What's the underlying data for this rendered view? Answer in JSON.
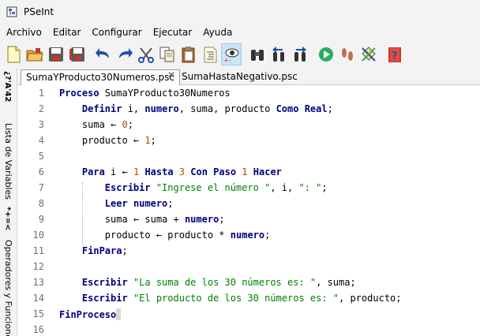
{
  "window": {
    "title": "PSeInt"
  },
  "menu": [
    "Archivo",
    "Editar",
    "Configurar",
    "Ejecutar",
    "Ayuda"
  ],
  "toolbar": [
    {
      "name": "new-file",
      "icon": "new-file-icon"
    },
    {
      "name": "open-file",
      "icon": "open-folder-icon"
    },
    {
      "name": "save",
      "icon": "save-icon"
    },
    {
      "name": "save-as",
      "icon": "save-as-icon"
    },
    {
      "name": "undo",
      "icon": "undo-icon"
    },
    {
      "name": "redo",
      "icon": "redo-icon"
    },
    {
      "name": "cut",
      "icon": "scissors-icon"
    },
    {
      "name": "copy",
      "icon": "copy-icon"
    },
    {
      "name": "paste",
      "icon": "paste-icon"
    },
    {
      "name": "indent",
      "icon": "indent-icon"
    },
    {
      "name": "watch-vars",
      "icon": "eye-icon"
    },
    {
      "name": "find",
      "icon": "binoculars-icon"
    },
    {
      "name": "find-prev",
      "icon": "find-prev-icon"
    },
    {
      "name": "find-next",
      "icon": "find-next-icon"
    },
    {
      "name": "run",
      "icon": "play-icon"
    },
    {
      "name": "step-by-step",
      "icon": "footsteps-icon"
    },
    {
      "name": "flowchart",
      "icon": "flowchart-icon"
    },
    {
      "name": "help",
      "icon": "help-icon"
    }
  ],
  "side_panels": {
    "variables": "Lista de Variables",
    "operators": "Operadores y Funciones",
    "variables_symbol": "*+=<",
    "top_symbol": "¿?'A'42"
  },
  "tabs": [
    {
      "label": "SumaYProducto30Numeros.psc",
      "active": true,
      "close": "✕"
    },
    {
      "label": "SumaHastaNegativo.psc",
      "active": false
    }
  ],
  "code": {
    "line_numbers": [
      "1",
      "2",
      "3",
      "4",
      "5",
      "6",
      "7",
      "8",
      "9",
      "10",
      "11",
      "12",
      "13",
      "14",
      "15",
      "16"
    ],
    "lines": [
      [
        [
          "kw",
          "Proceso"
        ],
        [
          "t",
          " SumaYProducto30Numeros"
        ]
      ],
      [
        [
          "t",
          "    "
        ],
        [
          "kw",
          "Definir"
        ],
        [
          "t",
          " i, "
        ],
        [
          "kw",
          "numero"
        ],
        [
          "t",
          ", suma, producto "
        ],
        [
          "kw",
          "Como Real"
        ],
        [
          "t",
          ";"
        ]
      ],
      [
        [
          "t",
          "    suma "
        ],
        [
          "op",
          "←"
        ],
        [
          "t",
          " "
        ],
        [
          "num",
          "0"
        ],
        [
          "t",
          ";"
        ]
      ],
      [
        [
          "t",
          "    producto "
        ],
        [
          "op",
          "←"
        ],
        [
          "t",
          " "
        ],
        [
          "num",
          "1"
        ],
        [
          "t",
          ";"
        ]
      ],
      [
        [
          "t",
          ""
        ]
      ],
      [
        [
          "t",
          "    "
        ],
        [
          "kw",
          "Para"
        ],
        [
          "t",
          " i "
        ],
        [
          "op",
          "←"
        ],
        [
          "t",
          " "
        ],
        [
          "num",
          "1"
        ],
        [
          "t",
          " "
        ],
        [
          "kw",
          "Hasta"
        ],
        [
          "t",
          " "
        ],
        [
          "num",
          "3"
        ],
        [
          "t",
          " "
        ],
        [
          "kw",
          "Con Paso"
        ],
        [
          "t",
          " "
        ],
        [
          "num",
          "1"
        ],
        [
          "t",
          " "
        ],
        [
          "kw",
          "Hacer"
        ]
      ],
      [
        [
          "t",
          "        "
        ],
        [
          "kw",
          "Escribir"
        ],
        [
          "t",
          " "
        ],
        [
          "str",
          "\"Ingrese el número \""
        ],
        [
          "t",
          ", i, "
        ],
        [
          "str",
          "\": \""
        ],
        [
          "t",
          ";"
        ]
      ],
      [
        [
          "t",
          "        "
        ],
        [
          "kw",
          "Leer"
        ],
        [
          "t",
          " "
        ],
        [
          "kw",
          "numero"
        ],
        [
          "t",
          ";"
        ]
      ],
      [
        [
          "t",
          "        suma "
        ],
        [
          "op",
          "←"
        ],
        [
          "t",
          " suma + "
        ],
        [
          "kw",
          "numero"
        ],
        [
          "t",
          ";"
        ]
      ],
      [
        [
          "t",
          "        producto "
        ],
        [
          "op",
          "←"
        ],
        [
          "t",
          " producto * "
        ],
        [
          "kw",
          "numero"
        ],
        [
          "t",
          ";"
        ]
      ],
      [
        [
          "t",
          "    "
        ],
        [
          "kw",
          "FinPara"
        ],
        [
          "t",
          ";"
        ]
      ],
      [
        [
          "t",
          ""
        ]
      ],
      [
        [
          "t",
          "    "
        ],
        [
          "kw",
          "Escribir"
        ],
        [
          "t",
          " "
        ],
        [
          "str",
          "\"La suma de los 30 números es: \""
        ],
        [
          "t",
          ", suma;"
        ]
      ],
      [
        [
          "t",
          "    "
        ],
        [
          "kw",
          "Escribir"
        ],
        [
          "t",
          " "
        ],
        [
          "str",
          "\"El producto de los 30 números es: \""
        ],
        [
          "t",
          ", producto;"
        ]
      ],
      [
        [
          "kw",
          "FinProceso"
        ]
      ],
      [
        [
          "t",
          ""
        ]
      ]
    ]
  }
}
